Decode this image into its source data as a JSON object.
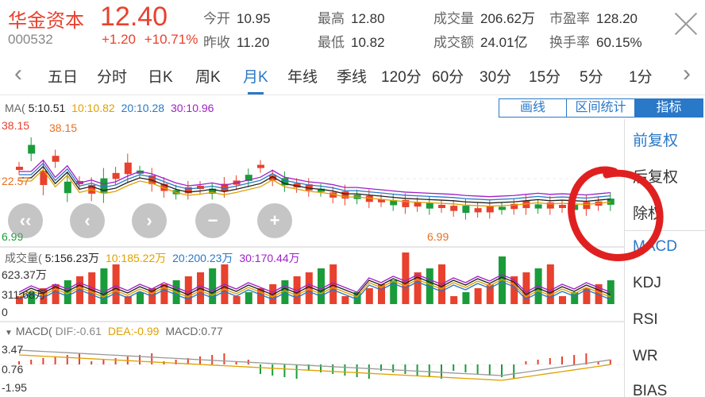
{
  "stock": {
    "name": "华金资本",
    "price": "12.40",
    "code": "000532",
    "change": "+1.20",
    "change_pct": "+10.71%"
  },
  "stats": [
    {
      "label": "今开",
      "value": "10.95"
    },
    {
      "label": "昨收",
      "value": "11.20"
    },
    {
      "label": "最高",
      "value": "12.80"
    },
    {
      "label": "最低",
      "value": "10.82"
    },
    {
      "label": "成交量",
      "value": "206.62万"
    },
    {
      "label": "成交额",
      "value": "24.01亿"
    },
    {
      "label": "市盈率",
      "value": "128.20"
    },
    {
      "label": "换手率",
      "value": "60.15%"
    }
  ],
  "tabs": [
    "五日",
    "分时",
    "日K",
    "周K",
    "月K",
    "年线",
    "季线",
    "120分",
    "60分",
    "30分",
    "15分",
    "5分",
    "1分"
  ],
  "active_tab": "月K",
  "nav_icons": {
    "prev": "chevron-left-icon",
    "next": "chevron-right-icon",
    "close": "close-icon"
  },
  "ma_legend": {
    "prefix": "MA(",
    "items": [
      {
        "text": "5:10.51",
        "color": "#222222"
      },
      {
        "text": "10:10.82",
        "color": "#e0a100"
      },
      {
        "text": "20:10.28",
        "color": "#2a78c8"
      },
      {
        "text": "30:10.96",
        "color": "#a020c8"
      }
    ]
  },
  "kline": {
    "high_label": "38.15",
    "high_label2": "38.15",
    "low_label": "6.99",
    "low_label2": "6.99",
    "mid_label": "22.57"
  },
  "volume": {
    "title": "成交量(",
    "items": [
      {
        "text": "5:156.23万",
        "color": "#222222"
      },
      {
        "text": "10:185.22万",
        "color": "#e0a100"
      },
      {
        "text": "20:200.23万",
        "color": "#2a78c8"
      },
      {
        "text": "30:170.44万",
        "color": "#a020c8"
      }
    ],
    "max_label": "623.37万",
    "mid_label": "311.68万",
    "zero_label": "0"
  },
  "macd": {
    "title": "MACD(",
    "dif": "DIF:-0.61",
    "dea": "DEA:-0.99",
    "macd": "MACD:0.77",
    "top_label": "3.47",
    "mid_label": "0.76",
    "bottom_label": "-1.95"
  },
  "toolbar": {
    "draw": "画线",
    "stats": "区间统计",
    "indicator": "指标"
  },
  "side_menu": [
    "前复权",
    "后复权",
    "除权",
    "MACD",
    "KDJ",
    "RSI",
    "WR",
    "BIAS"
  ],
  "controls": [
    "‹‹",
    "‹",
    "›",
    "−",
    "+"
  ],
  "colors": {
    "up": "#e8412d",
    "down": "#1a9c3a",
    "accent": "#2a78c8",
    "annotation": "#e02020"
  }
}
